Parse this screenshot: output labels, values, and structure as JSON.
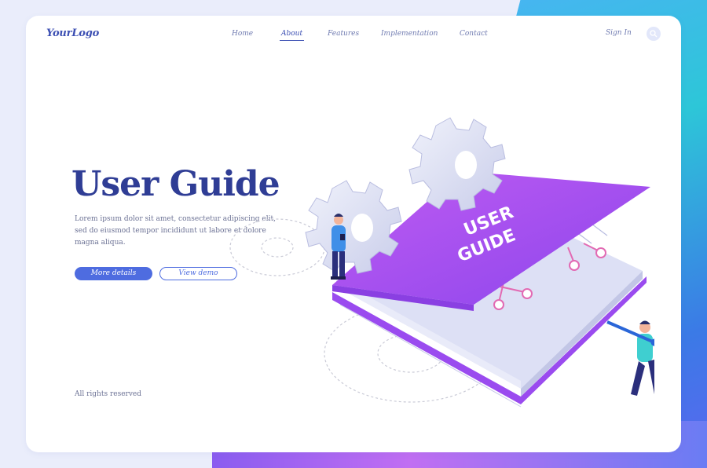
{
  "brand": {
    "logo": "YourLogo"
  },
  "nav": {
    "items": [
      {
        "label": "Home"
      },
      {
        "label": "About"
      },
      {
        "label": "Features"
      },
      {
        "label": "Implementation"
      },
      {
        "label": "Contact"
      }
    ],
    "active": "About"
  },
  "header": {
    "signin_label": "Sign In",
    "search_icon": "search-icon"
  },
  "hero": {
    "title": "User Guide",
    "description": "Lorem ipsum dolor sit amet, consectetur adipiscing elit, sed do eiusmod tempor incididunt ut labore et dolore magna aliqua.",
    "primary_button": "More details",
    "secondary_button": "View demo",
    "book_cover_text": [
      "USER",
      "GUIDE"
    ]
  },
  "footer": {
    "copyright": "All rights reserved"
  },
  "colors": {
    "accent": "#4e6ce0",
    "title": "#2f3d95",
    "book": "#a24df0",
    "background_gradient": [
      "#2dc6d8",
      "#5a67f0"
    ]
  }
}
